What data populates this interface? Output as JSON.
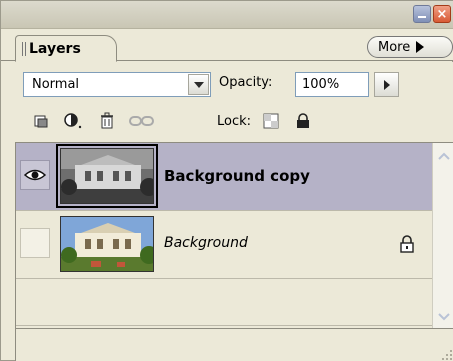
{
  "panel": {
    "tab_label": "Layers",
    "more_label": "More"
  },
  "controls": {
    "blend_mode": "Normal",
    "opacity_label": "Opacity:",
    "opacity_value": "100%",
    "lock_label": "Lock:"
  },
  "layers": [
    {
      "name": "Background copy",
      "visible": true,
      "selected": true,
      "locked": false
    },
    {
      "name": "Background",
      "visible": false,
      "selected": false,
      "locked": true
    }
  ],
  "colors": {
    "panel_bg": "#ece9d8",
    "selected_row": "#b5b2c7"
  }
}
